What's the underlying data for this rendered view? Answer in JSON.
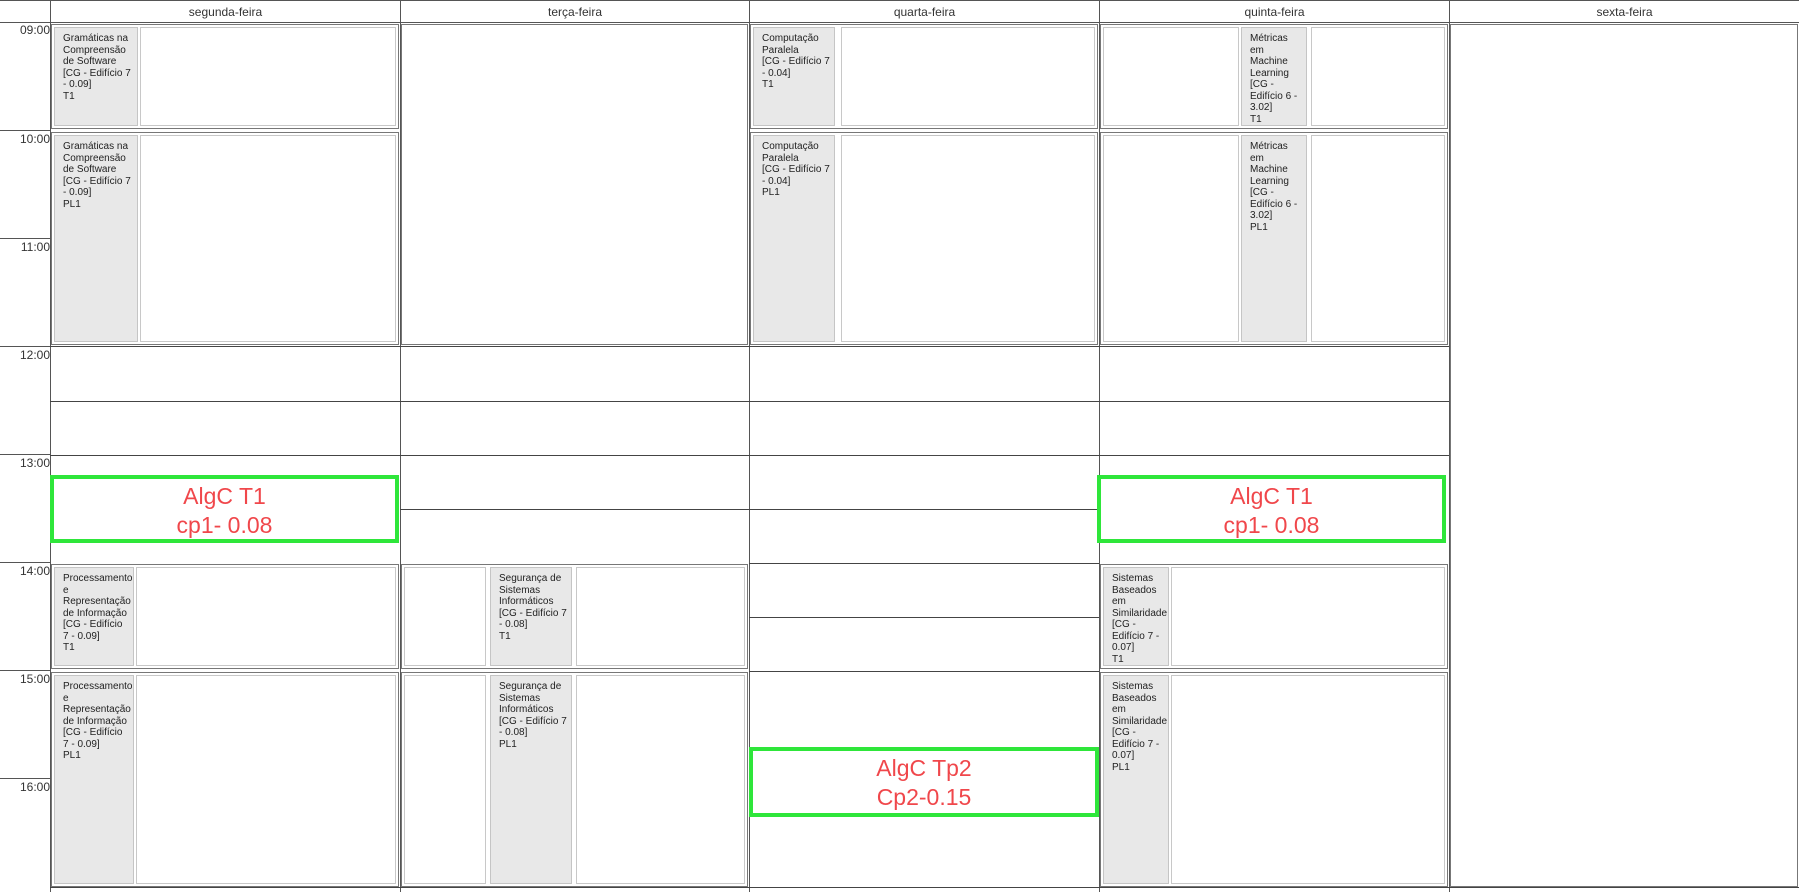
{
  "days": [
    "segunda-feira",
    "terça-feira",
    "quarta-feira",
    "quinta-feira",
    "sexta-feira"
  ],
  "times": [
    "09:00",
    "10:00",
    "11:00",
    "12:00",
    "13:00",
    "14:00",
    "15:00",
    "16:00"
  ],
  "classes": {
    "gcs_t1": [
      "Gramáticas na Compreensão de Software",
      "[CG - Edifício 7 - 0.09]",
      "T1"
    ],
    "gcs_pl1": [
      "Gramáticas na Compreensão de Software",
      "[CG - Edifício 7 - 0.09]",
      "PL1"
    ],
    "cp_t1": [
      "Computação Paralela",
      "[CG - Edifício 7 - 0.04]",
      "T1"
    ],
    "cp_pl1": [
      "Computação Paralela",
      "[CG - Edifício 7 - 0.04]",
      "PL1"
    ],
    "mml_t1": [
      "Métricas em Machine Learning",
      "[CG - Edifício 6 - 3.02]",
      "T1"
    ],
    "mml_pl1": [
      "Métricas em Machine Learning",
      "[CG - Edifício 6 - 3.02]",
      "PL1"
    ],
    "pri_t1": [
      "Processamento e Representação de Informação",
      "[CG - Edifício 7 - 0.09]",
      "T1"
    ],
    "pri_pl1": [
      "Processamento e Representação de Informação",
      "[CG - Edifício 7 - 0.09]",
      "PL1"
    ],
    "ssi_t1": [
      "Segurança de Sistemas Informáticos",
      "[CG - Edifício 7 - 0.08]",
      "T1"
    ],
    "ssi_pl1": [
      "Segurança de Sistemas Informáticos",
      "[CG - Edifício 7 - 0.08]",
      "PL1"
    ],
    "sbs_t1": [
      "Sistemas Baseados em Similaridade",
      "[CG - Edifício 7 - 0.07]",
      "T1"
    ],
    "sbs_pl1": [
      "Sistemas Baseados em Similaridade",
      "[CG - Edifício 7 - 0.07]",
      "PL1"
    ]
  },
  "annotations": {
    "mon_algc": [
      "AlgC T1",
      "cp1- 0.08"
    ],
    "thu_algc": [
      "AlgC T1",
      "cp1- 0.08"
    ],
    "wed_algc": [
      "AlgC Tp2",
      "Cp2-0.15"
    ]
  },
  "colors": {
    "annotation_border": "#2ee63a",
    "annotation_text": "#f0474b",
    "label_bg": "#e8e8e8"
  }
}
